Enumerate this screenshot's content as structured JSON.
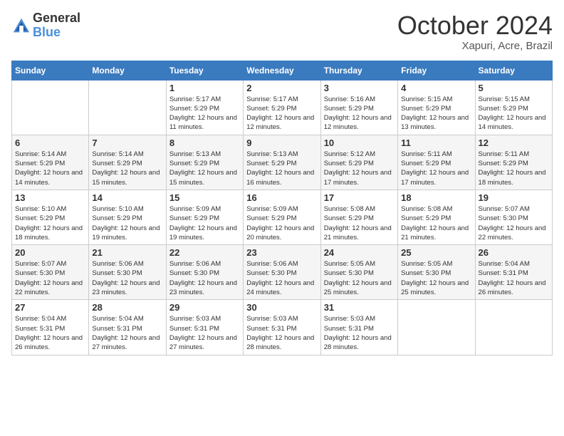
{
  "header": {
    "logo_general": "General",
    "logo_blue": "Blue",
    "month": "October 2024",
    "location": "Xapuri, Acre, Brazil"
  },
  "days_of_week": [
    "Sunday",
    "Monday",
    "Tuesday",
    "Wednesday",
    "Thursday",
    "Friday",
    "Saturday"
  ],
  "weeks": [
    [
      {
        "day": "",
        "info": ""
      },
      {
        "day": "",
        "info": ""
      },
      {
        "day": "1",
        "info": "Sunrise: 5:17 AM\nSunset: 5:29 PM\nDaylight: 12 hours\nand 11 minutes."
      },
      {
        "day": "2",
        "info": "Sunrise: 5:17 AM\nSunset: 5:29 PM\nDaylight: 12 hours\nand 12 minutes."
      },
      {
        "day": "3",
        "info": "Sunrise: 5:16 AM\nSunset: 5:29 PM\nDaylight: 12 hours\nand 12 minutes."
      },
      {
        "day": "4",
        "info": "Sunrise: 5:15 AM\nSunset: 5:29 PM\nDaylight: 12 hours\nand 13 minutes."
      },
      {
        "day": "5",
        "info": "Sunrise: 5:15 AM\nSunset: 5:29 PM\nDaylight: 12 hours\nand 14 minutes."
      }
    ],
    [
      {
        "day": "6",
        "info": "Sunrise: 5:14 AM\nSunset: 5:29 PM\nDaylight: 12 hours\nand 14 minutes."
      },
      {
        "day": "7",
        "info": "Sunrise: 5:14 AM\nSunset: 5:29 PM\nDaylight: 12 hours\nand 15 minutes."
      },
      {
        "day": "8",
        "info": "Sunrise: 5:13 AM\nSunset: 5:29 PM\nDaylight: 12 hours\nand 15 minutes."
      },
      {
        "day": "9",
        "info": "Sunrise: 5:13 AM\nSunset: 5:29 PM\nDaylight: 12 hours\nand 16 minutes."
      },
      {
        "day": "10",
        "info": "Sunrise: 5:12 AM\nSunset: 5:29 PM\nDaylight: 12 hours\nand 17 minutes."
      },
      {
        "day": "11",
        "info": "Sunrise: 5:11 AM\nSunset: 5:29 PM\nDaylight: 12 hours\nand 17 minutes."
      },
      {
        "day": "12",
        "info": "Sunrise: 5:11 AM\nSunset: 5:29 PM\nDaylight: 12 hours\nand 18 minutes."
      }
    ],
    [
      {
        "day": "13",
        "info": "Sunrise: 5:10 AM\nSunset: 5:29 PM\nDaylight: 12 hours\nand 18 minutes."
      },
      {
        "day": "14",
        "info": "Sunrise: 5:10 AM\nSunset: 5:29 PM\nDaylight: 12 hours\nand 19 minutes."
      },
      {
        "day": "15",
        "info": "Sunrise: 5:09 AM\nSunset: 5:29 PM\nDaylight: 12 hours\nand 19 minutes."
      },
      {
        "day": "16",
        "info": "Sunrise: 5:09 AM\nSunset: 5:29 PM\nDaylight: 12 hours\nand 20 minutes."
      },
      {
        "day": "17",
        "info": "Sunrise: 5:08 AM\nSunset: 5:29 PM\nDaylight: 12 hours\nand 21 minutes."
      },
      {
        "day": "18",
        "info": "Sunrise: 5:08 AM\nSunset: 5:29 PM\nDaylight: 12 hours\nand 21 minutes."
      },
      {
        "day": "19",
        "info": "Sunrise: 5:07 AM\nSunset: 5:30 PM\nDaylight: 12 hours\nand 22 minutes."
      }
    ],
    [
      {
        "day": "20",
        "info": "Sunrise: 5:07 AM\nSunset: 5:30 PM\nDaylight: 12 hours\nand 22 minutes."
      },
      {
        "day": "21",
        "info": "Sunrise: 5:06 AM\nSunset: 5:30 PM\nDaylight: 12 hours\nand 23 minutes."
      },
      {
        "day": "22",
        "info": "Sunrise: 5:06 AM\nSunset: 5:30 PM\nDaylight: 12 hours\nand 23 minutes."
      },
      {
        "day": "23",
        "info": "Sunrise: 5:06 AM\nSunset: 5:30 PM\nDaylight: 12 hours\nand 24 minutes."
      },
      {
        "day": "24",
        "info": "Sunrise: 5:05 AM\nSunset: 5:30 PM\nDaylight: 12 hours\nand 25 minutes."
      },
      {
        "day": "25",
        "info": "Sunrise: 5:05 AM\nSunset: 5:30 PM\nDaylight: 12 hours\nand 25 minutes."
      },
      {
        "day": "26",
        "info": "Sunrise: 5:04 AM\nSunset: 5:31 PM\nDaylight: 12 hours\nand 26 minutes."
      }
    ],
    [
      {
        "day": "27",
        "info": "Sunrise: 5:04 AM\nSunset: 5:31 PM\nDaylight: 12 hours\nand 26 minutes."
      },
      {
        "day": "28",
        "info": "Sunrise: 5:04 AM\nSunset: 5:31 PM\nDaylight: 12 hours\nand 27 minutes."
      },
      {
        "day": "29",
        "info": "Sunrise: 5:03 AM\nSunset: 5:31 PM\nDaylight: 12 hours\nand 27 minutes."
      },
      {
        "day": "30",
        "info": "Sunrise: 5:03 AM\nSunset: 5:31 PM\nDaylight: 12 hours\nand 28 minutes."
      },
      {
        "day": "31",
        "info": "Sunrise: 5:03 AM\nSunset: 5:31 PM\nDaylight: 12 hours\nand 28 minutes."
      },
      {
        "day": "",
        "info": ""
      },
      {
        "day": "",
        "info": ""
      }
    ]
  ]
}
